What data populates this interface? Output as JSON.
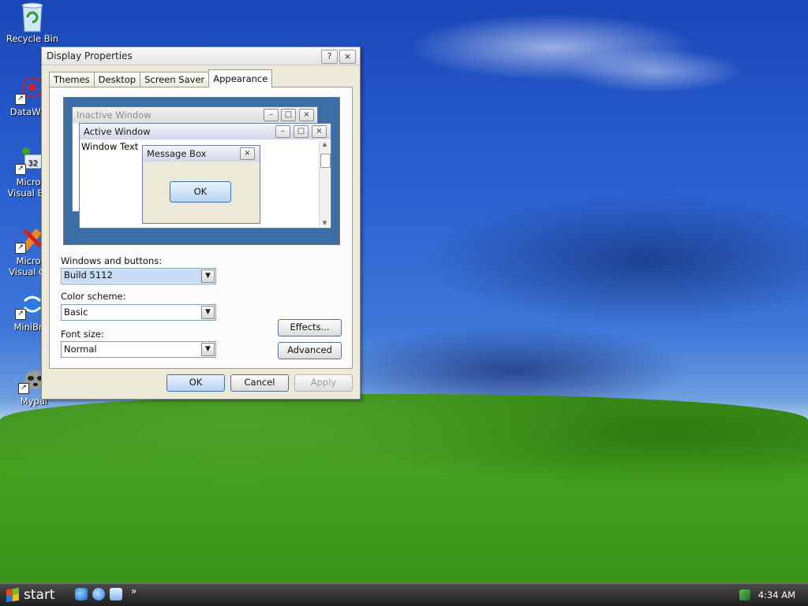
{
  "desktop": {
    "icons": [
      {
        "label": "Recycle Bin"
      },
      {
        "label": "DataWag"
      },
      {
        "label": "Micros",
        "label2": "Visual Bas"
      },
      {
        "label": "Micros",
        "label2": "Visual C+"
      },
      {
        "label": "MiniBro"
      },
      {
        "label": "Mypal"
      }
    ]
  },
  "dialog": {
    "title": "Display Properties",
    "help_glyph": "?",
    "close_glyph": "×",
    "tabs": [
      {
        "label": "Themes"
      },
      {
        "label": "Desktop"
      },
      {
        "label": "Screen Saver"
      },
      {
        "label": "Appearance"
      }
    ],
    "preview": {
      "inactive_title": "Inactive Window",
      "active_title": "Active Window",
      "window_text": "Window Text",
      "msgbox_title": "Message Box",
      "msgbox_ok": "OK",
      "min_glyph": "–",
      "max_glyph": "□",
      "close_glyph": "×",
      "scroll_up": "▲",
      "scroll_down": "▼"
    },
    "windows_buttons_label": "Windows and buttons:",
    "windows_buttons_value": "Build 5112",
    "color_scheme_label": "Color scheme:",
    "color_scheme_value": "Basic",
    "font_size_label": "Font size:",
    "font_size_value": "Normal",
    "dropdown_arrow": "▼",
    "effects_label": "Effects...",
    "advanced_label": "Advanced",
    "ok_label": "OK",
    "cancel_label": "Cancel",
    "apply_label": "Apply"
  },
  "taskbar": {
    "start_label": "start",
    "quicklaunch_more": "»",
    "clock": "4:34 AM"
  }
}
